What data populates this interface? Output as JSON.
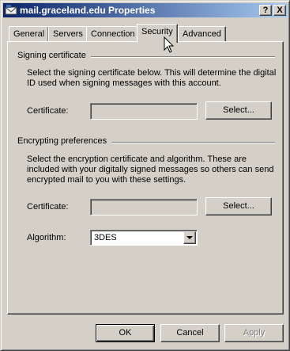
{
  "window": {
    "title": "mail.graceland.edu Properties",
    "help_label": "?",
    "close_label": "X"
  },
  "tabs": [
    {
      "label": "General"
    },
    {
      "label": "Servers"
    },
    {
      "label": "Connection"
    },
    {
      "label": "Security"
    },
    {
      "label": "Advanced"
    }
  ],
  "active_tab": "Security",
  "signing": {
    "heading": "Signing certificate",
    "description": "Select the signing certificate below. This will determine the digital ID used when signing messages with this account.",
    "certificate_label": "Certificate:",
    "certificate_value": "",
    "select_label": "Select..."
  },
  "encrypting": {
    "heading": "Encrypting preferences",
    "description": "Select the encryption certificate and algorithm. These are included with your digitally signed messages so others can send encrypted mail to you with these settings.",
    "certificate_label": "Certificate:",
    "certificate_value": "",
    "select_label": "Select...",
    "algorithm_label": "Algorithm:",
    "algorithm_value": "3DES"
  },
  "footer": {
    "ok_label": "OK",
    "cancel_label": "Cancel",
    "apply_label": "Apply"
  },
  "colors": {
    "titlebar_start": "#0a246a",
    "titlebar_end": "#a6caf0",
    "face": "#d4d0c8"
  }
}
